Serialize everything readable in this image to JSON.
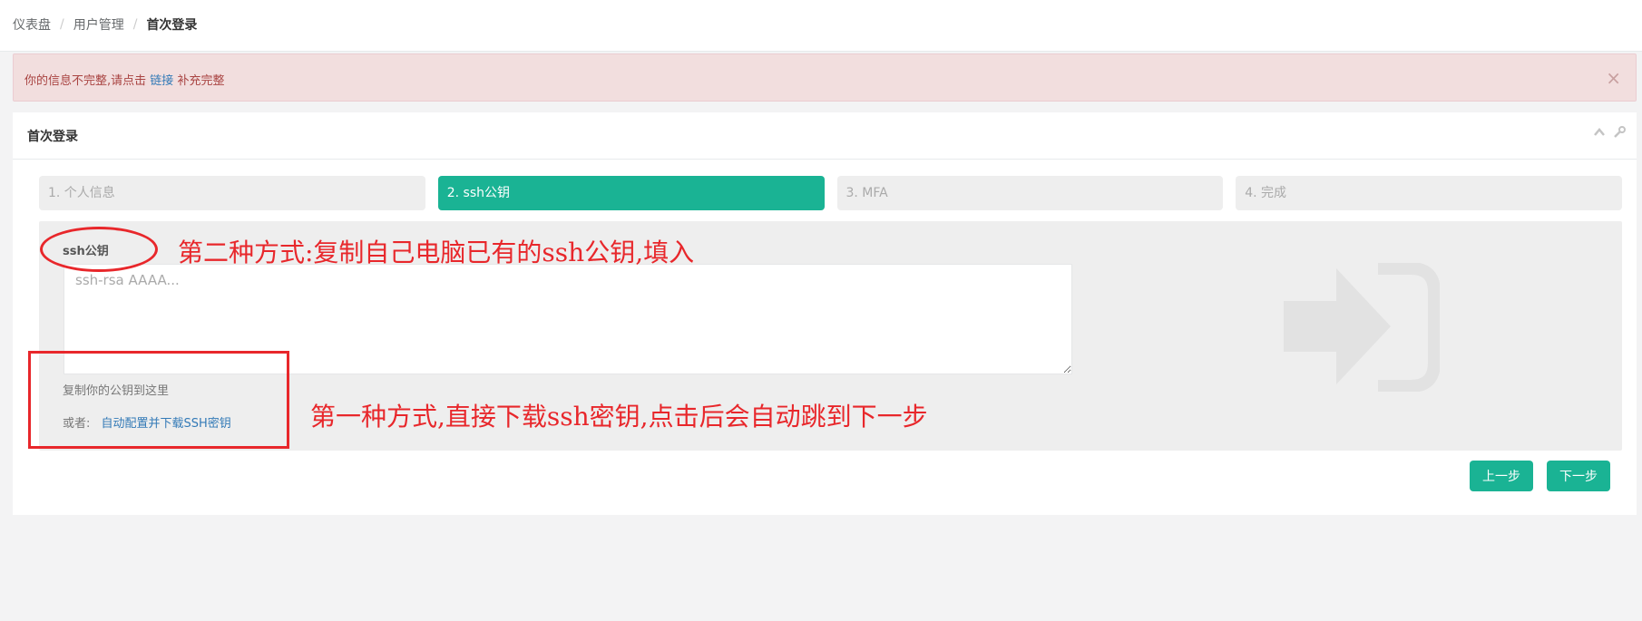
{
  "breadcrumb": {
    "items": [
      "仪表盘",
      "用户管理",
      "首次登录"
    ],
    "separator": "/"
  },
  "alert": {
    "text_before": "你的信息不完整,请点击",
    "link": "链接",
    "text_after": "补充完整",
    "close": "×"
  },
  "panel": {
    "title": "首次登录",
    "tools": {
      "collapse_icon": "chevron-up-icon",
      "settings_icon": "wrench-icon"
    }
  },
  "steps": [
    {
      "label": "1. 个人信息",
      "active": false
    },
    {
      "label": "2. ssh公钥",
      "active": true
    },
    {
      "label": "3. MFA",
      "active": false
    },
    {
      "label": "4. 完成",
      "active": false
    }
  ],
  "form": {
    "label": "ssh公钥",
    "placeholder": "ssh-rsa AAAA...",
    "value": "",
    "help": "复制你的公钥到这里",
    "or_label": "或者:",
    "auto_link": "自动配置并下载SSH密钥"
  },
  "buttons": {
    "prev": "上一步",
    "next": "下一步"
  },
  "annotations": {
    "second_method": "第二种方式:复制自己电脑已有的ssh公钥,填入",
    "first_method": "第一种方式,直接下载ssh密钥,点击后会自动跳到下一步"
  },
  "colors": {
    "primary": "#1ab394",
    "alert_bg": "#f2dede",
    "alert_text": "#a94442",
    "link": "#337ab7",
    "annotation": "#e8272b"
  }
}
